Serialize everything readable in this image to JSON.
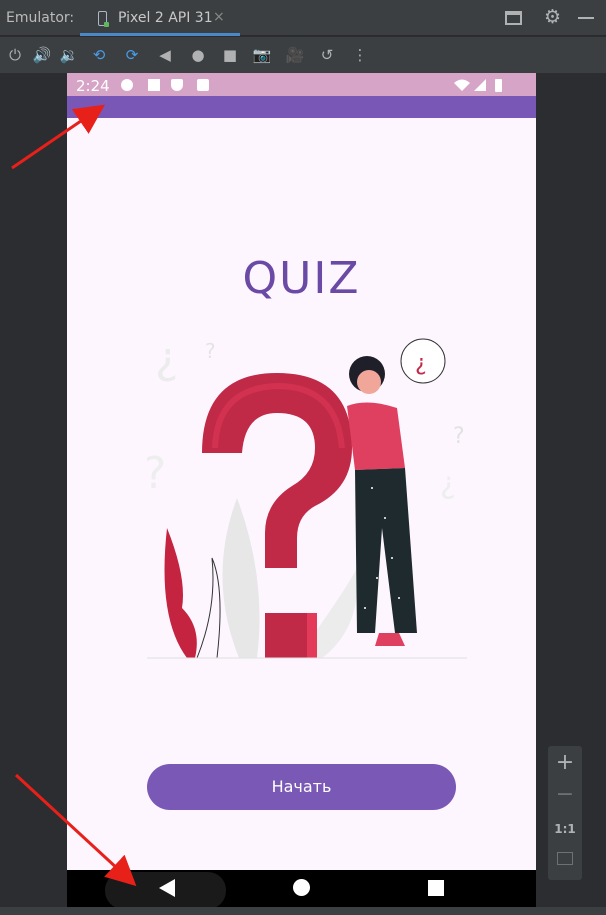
{
  "emulator": {
    "label": "Emulator:",
    "tab_name": "Pixel 2 API 31",
    "tab_close": "×"
  },
  "toolbar": {
    "icons": [
      "power-icon",
      "volume-up-icon",
      "volume-down-icon",
      "rotate-left-icon",
      "rotate-right-icon",
      "back-icon",
      "home-icon",
      "overview-icon",
      "camera-icon",
      "video-icon",
      "snapshot-icon",
      "more-icon"
    ]
  },
  "device": {
    "status_time": "2:24",
    "app_title": "QUIZ",
    "start_button": "Начать"
  },
  "zoom": {
    "plus": "+",
    "minus": "−",
    "one_to_one": "1:1"
  },
  "colors": {
    "accent": "#7957b6",
    "status_bar": "#d6a4c6",
    "question_mark": "#c02a47",
    "arrow": "#e8201a"
  }
}
